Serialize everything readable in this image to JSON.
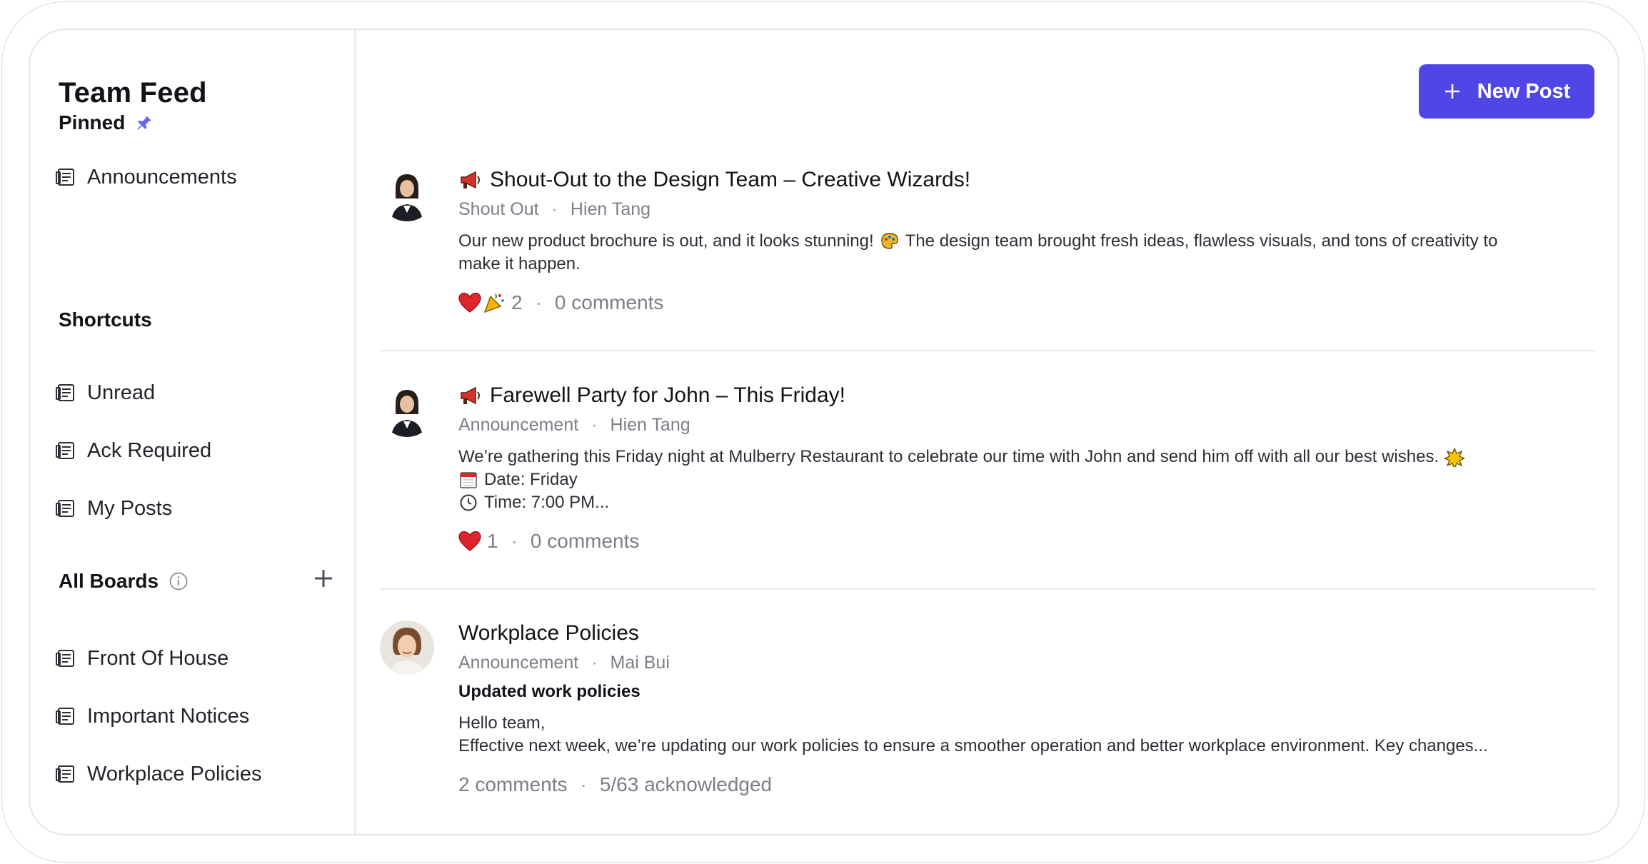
{
  "app": {
    "title": "Team Feed"
  },
  "sidebar": {
    "pinned_heading": "Pinned",
    "pinned_items": [
      {
        "label": "Announcements"
      }
    ],
    "shortcuts_heading": "Shortcuts",
    "shortcut_items": [
      {
        "label": "Unread"
      },
      {
        "label": "Ack Required"
      },
      {
        "label": "My Posts"
      }
    ],
    "boards_heading": "All Boards",
    "board_items": [
      {
        "label": "Front Of House"
      },
      {
        "label": "Important Notices"
      },
      {
        "label": "Workplace Policies"
      }
    ]
  },
  "toolbar": {
    "new_post_label": "New Post"
  },
  "posts": [
    {
      "title": "Shout-Out to the Design Team – Creative Wizards!",
      "category": "Shout Out",
      "author": "Hien Tang",
      "text_part1": "Our new product brochure is out, and it looks stunning!",
      "text_part2": "The design team brought fresh ideas, flawless visuals, and tons of creativity to",
      "text_line2": "make it happen.",
      "reaction_count": "2",
      "comments": "0 comments"
    },
    {
      "title": "Farewell Party for John – This Friday!",
      "category": "Announcement",
      "author": "Hien Tang",
      "text_line1": "We’re gathering this Friday night at Mulberry Restaurant to celebrate our time with John and send him off with all our best wishes.",
      "date_line": "Date: Friday",
      "time_line": "Time: 7:00 PM...",
      "reaction_count": "1",
      "comments": "0 comments"
    },
    {
      "title": "Workplace Policies",
      "category": "Announcement",
      "author": "Mai Bui",
      "subtitle": "Updated work policies",
      "text_line1": "Hello team,",
      "text_line2": "Effective next week, we’re updating our work policies to ensure a smoother operation and better workplace environment. Key changes...",
      "comments": "2 comments",
      "acknowledged": "5/63 acknowledged"
    }
  ],
  "colors": {
    "accent": "#4f46e5",
    "muted_text": "#7a7f88",
    "divider": "#e6e8ec"
  },
  "icons": [
    "pin-icon",
    "board-icon",
    "info-icon",
    "plus-icon",
    "megaphone-icon",
    "heart-icon",
    "party-popper-icon",
    "art-palette-icon",
    "sparkle-icon",
    "calendar-icon",
    "clock-icon"
  ]
}
